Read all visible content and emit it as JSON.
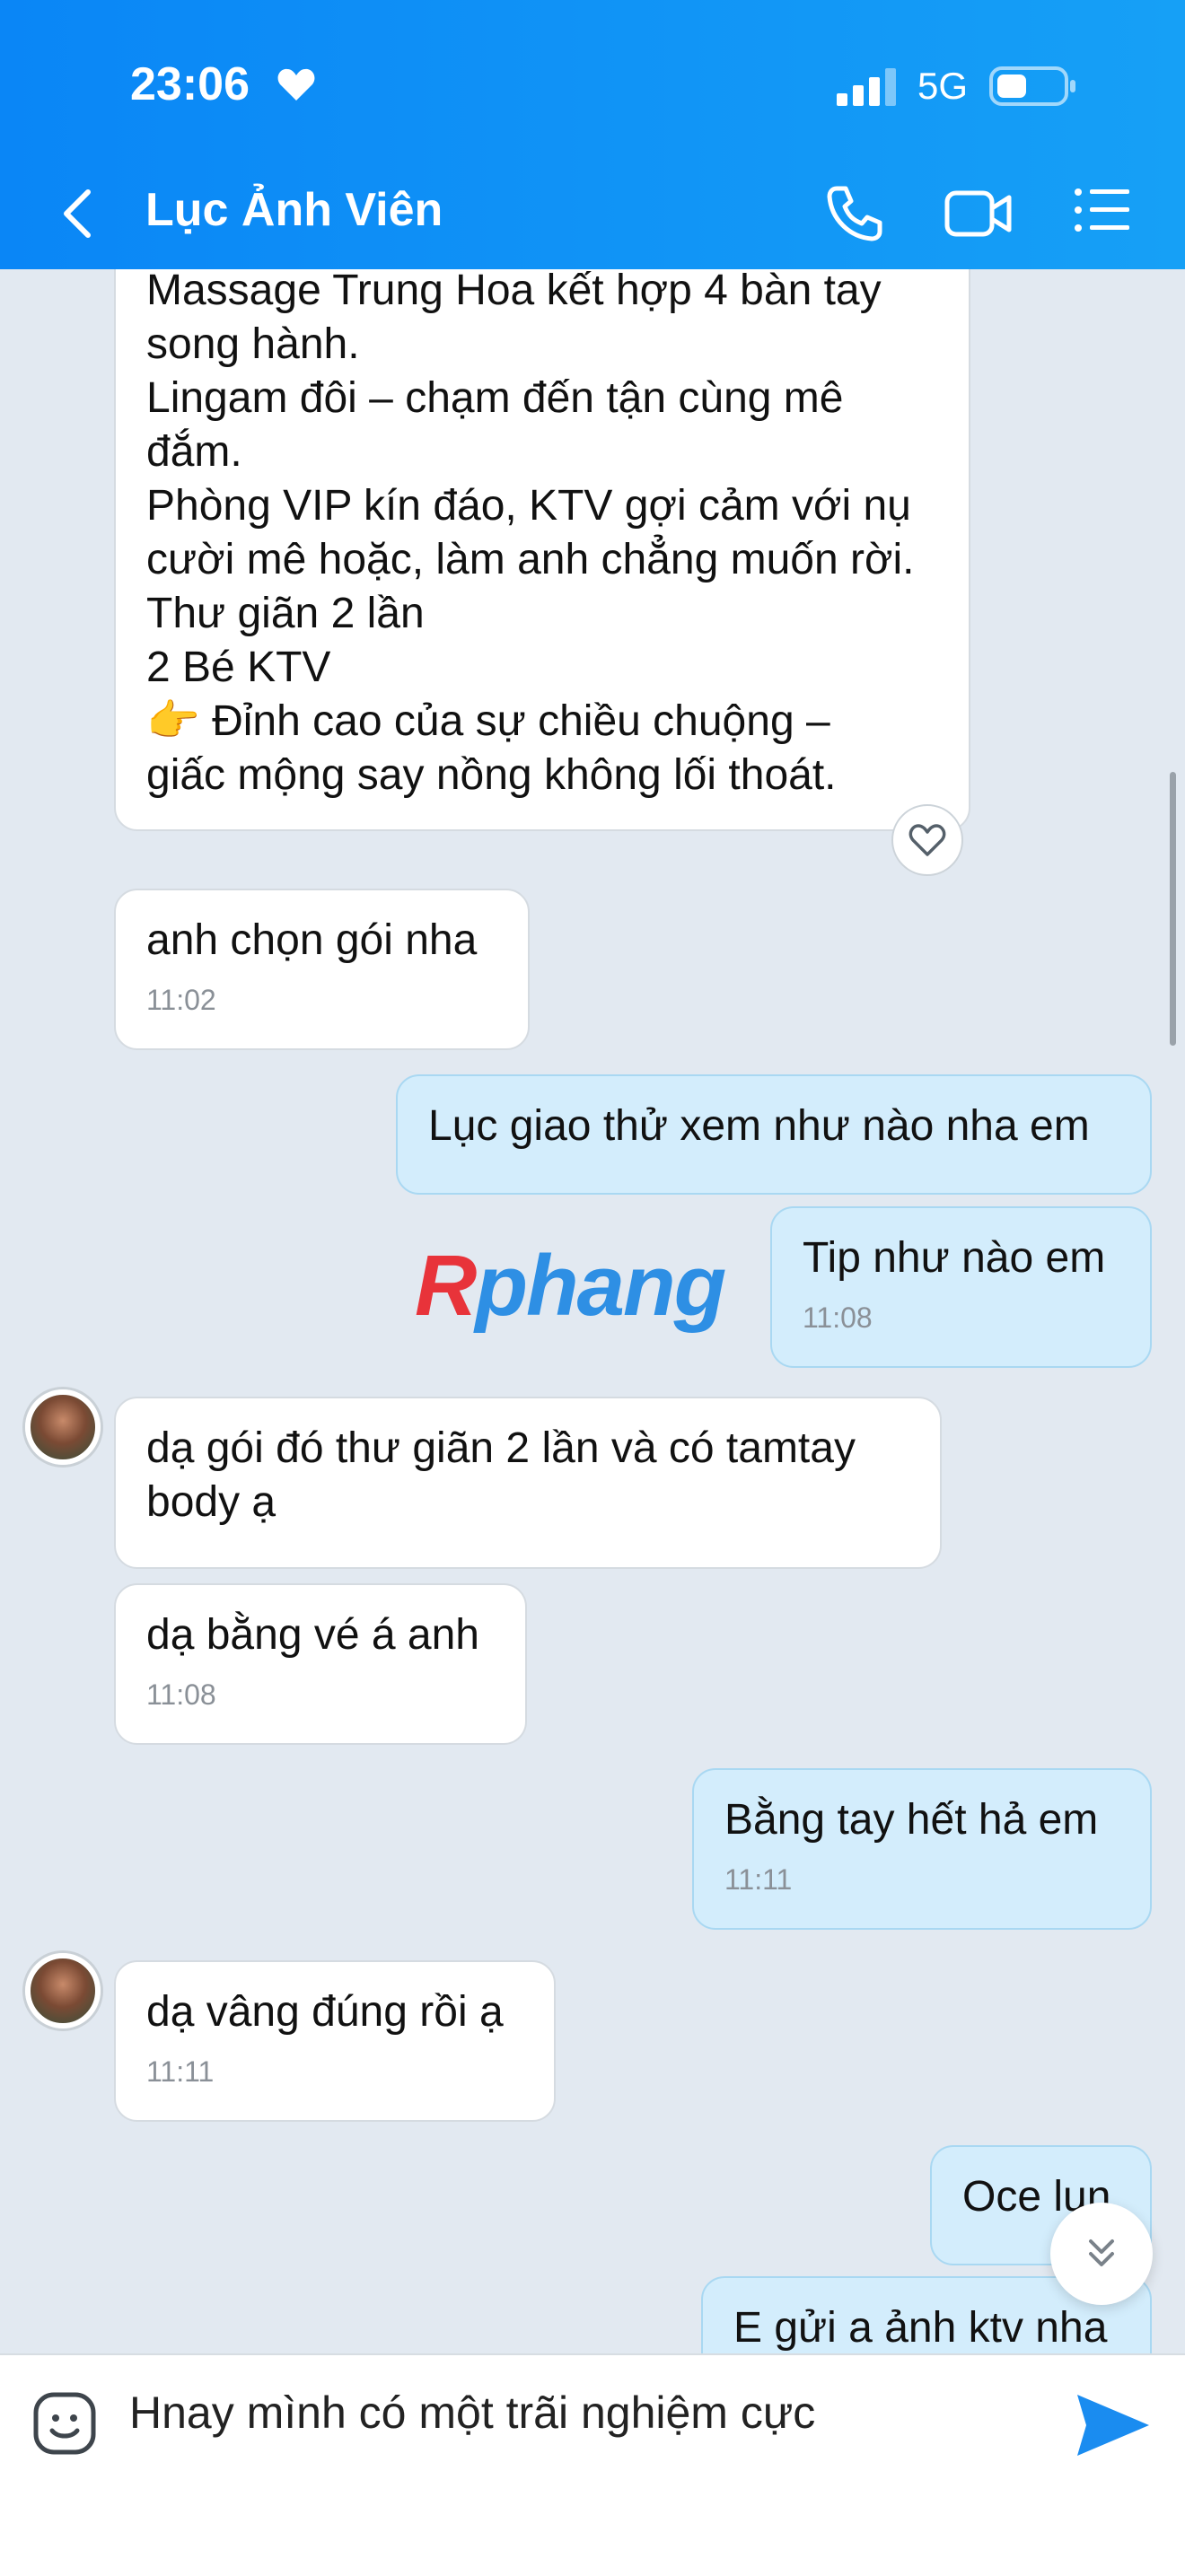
{
  "status_bar": {
    "time": "23:06",
    "network": "5G"
  },
  "header": {
    "contact_name": "Lục Ảnh Viên"
  },
  "messages": [
    {
      "text": "Massage Trung Hoa kết hợp 4 bàn tay\nsong hành.\nLingam đôi – chạm đến tận cùng mê\nđắm.\nPhòng VIP kín đáo, KTV gợi cảm với nụ\ncười mê hoặc, làm anh chẳng muốn rời.\nThư giãn 2 lần\n2 Bé KTV\n👉 Đỉnh cao của sự chiều chuộng –\ngiấc mộng say nồng không lối thoát."
    },
    {
      "text": "anh chọn gói nha",
      "time": "11:02"
    },
    {
      "text": "Lục giao thử xem như nào nha em"
    },
    {
      "text": "Tip như nào em",
      "time": "11:08"
    },
    {
      "text": "dạ gói đó thư giãn 2 lần và có tamtay\nbody ạ"
    },
    {
      "text": "dạ bằng vé á anh",
      "time": "11:08"
    },
    {
      "text": "Bằng tay hết hả em",
      "time": "11:11"
    },
    {
      "text": "dạ vâng đúng rồi ạ",
      "time": "11:11"
    },
    {
      "text": "Oce lun"
    },
    {
      "text": "E gửi a ảnh ktv nha"
    }
  ],
  "watermark": {
    "first": "R",
    "rest": "phang"
  },
  "composer": {
    "draft": "Hnay mình có một trãi nghiệm cực"
  }
}
